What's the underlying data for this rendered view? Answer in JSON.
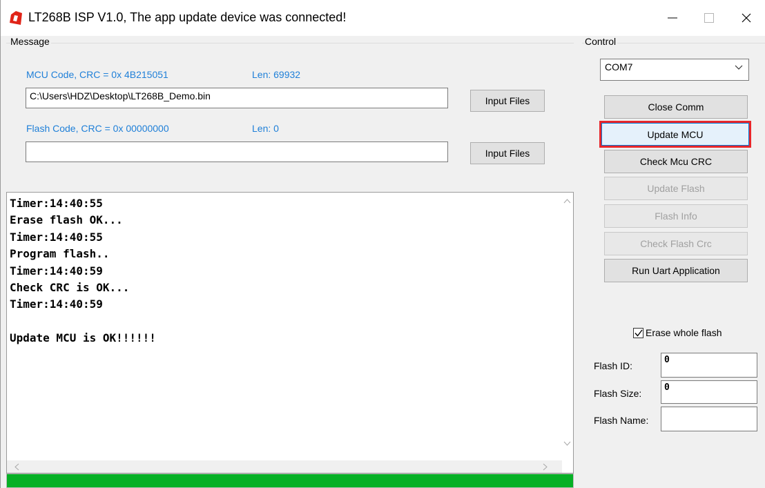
{
  "window": {
    "title": "LT268B ISP V1.0, The app update device was connected!"
  },
  "message_group": {
    "label": "Message",
    "mcu_crc_label": "MCU Code, CRC = 0x 4B215051",
    "mcu_len_label": "Len:  69932",
    "mcu_file_path": "C:\\Users\\HDZ\\Desktop\\LT268B_Demo.bin",
    "mcu_input_button": "Input Files",
    "flash_crc_label": "Flash Code, CRC = 0x 00000000",
    "flash_len_label": "Len:  0",
    "flash_file_path": "",
    "flash_input_button": "Input Files"
  },
  "log": {
    "lines": [
      "Timer:14:40:55",
      "Erase flash OK...",
      "Timer:14:40:55",
      "Program flash..",
      "Timer:14:40:59",
      "Check CRC is OK...",
      "Timer:14:40:59",
      "",
      "Update MCU is OK!!!!!!"
    ],
    "progress_fraction": 1.0
  },
  "control_group": {
    "label": "Control",
    "port_selected": "COM7",
    "buttons": {
      "close_comm": "Close Comm",
      "update_mcu": "Update MCU",
      "check_mcu_crc": "Check Mcu CRC",
      "update_flash": "Update Flash",
      "flash_info": "Flash Info",
      "check_flash_crc": "Check Flash Crc",
      "run_uart": "Run Uart Application"
    },
    "erase_whole_flash_label": "Erase whole flash",
    "erase_whole_flash_checked": true,
    "flash_id_label": "Flash ID:",
    "flash_id_value": "0",
    "flash_size_label": "Flash Size:",
    "flash_size_value": "0",
    "flash_name_label": "Flash Name:",
    "flash_name_value": ""
  },
  "colors": {
    "accent_blue": "#1e7fd8",
    "progress_green": "#06b025",
    "highlight_red": "#e8262a"
  }
}
